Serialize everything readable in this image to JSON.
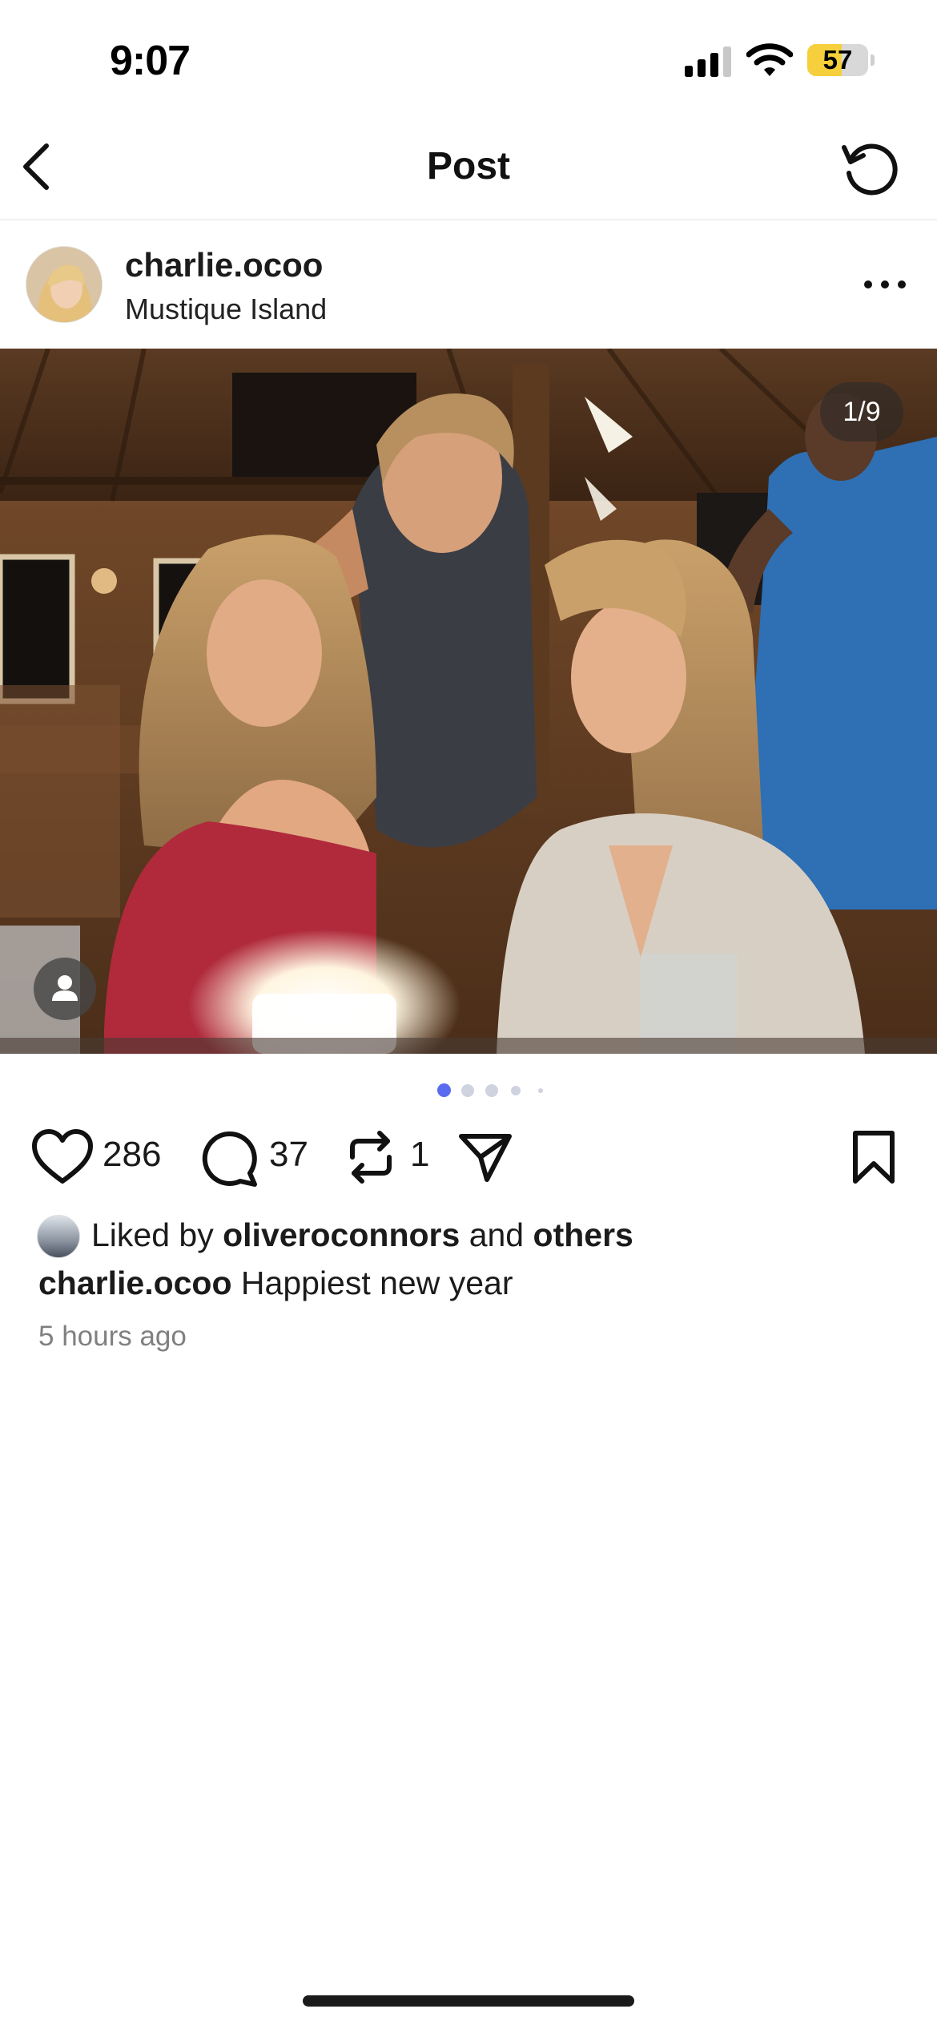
{
  "status_bar": {
    "time": "9:07",
    "battery_level": "57",
    "battery_fill_percent": 57,
    "battery_color": "#f6cf3c",
    "icons": [
      "signal-icon",
      "wifi-icon",
      "battery-icon"
    ]
  },
  "nav": {
    "title": "Post",
    "back_icon": "chevron-left-icon",
    "refresh_icon": "refresh-icon"
  },
  "post": {
    "username": "charlie.ocoo",
    "location": "Mustique Island",
    "more_icon": "more-horizontal-icon",
    "photo": {
      "counter": "1/9",
      "current_index": 1,
      "total": 9,
      "tag_icon": "person-icon"
    },
    "carousel": {
      "visible_dots": 5,
      "active_dot": 0,
      "active_color": "#5b6bf0"
    },
    "actions": {
      "like_count": "286",
      "comment_count": "37",
      "repost_count": "1",
      "icons": [
        "heart-icon",
        "comment-icon",
        "repost-icon",
        "send-icon",
        "bookmark-icon"
      ]
    },
    "liked_by": {
      "prefix": "Liked by",
      "user": "oliveroconnors",
      "and": "and",
      "others": "others"
    },
    "caption": {
      "username": "charlie.ocoo",
      "text": "Happiest new year"
    },
    "timestamp": "5 hours ago"
  }
}
